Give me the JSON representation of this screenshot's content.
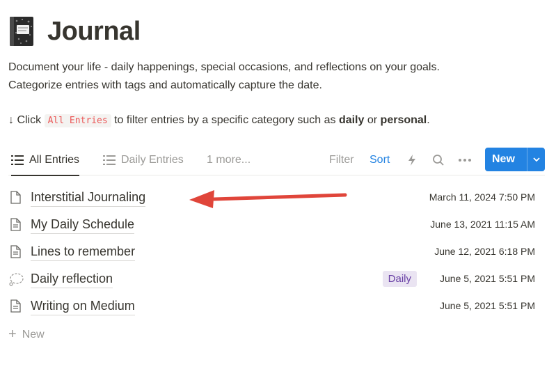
{
  "page": {
    "title": "Journal",
    "icon": "composition-notebook-icon",
    "description_line1": "Document your life - daily happenings, special occasions, and reflections on your goals.",
    "description_line2": "Categorize entries with tags and automatically capture the date.",
    "hint_prefix": "↓ Click",
    "hint_code": "All Entries",
    "hint_middle": "to filter entries by a specific category such as",
    "hint_bold1": "daily",
    "hint_or": "or",
    "hint_bold2": "personal",
    "hint_end": "."
  },
  "views": {
    "tabs": [
      {
        "label": "All Entries",
        "active": true
      },
      {
        "label": "Daily Entries",
        "active": false
      }
    ],
    "more_label": "1 more...",
    "filter_label": "Filter",
    "sort_label": "Sort",
    "new_label": "New"
  },
  "entries": [
    {
      "title": "Interstitial Journaling",
      "date": "March 11, 2024 7:50 PM",
      "tag": "",
      "icon": "page-icon"
    },
    {
      "title": "My Daily Schedule",
      "date": "June 13, 2021 11:15 AM",
      "tag": "",
      "icon": "doc-icon"
    },
    {
      "title": "Lines to remember",
      "date": "June 12, 2021 6:18 PM",
      "tag": "",
      "icon": "doc-icon"
    },
    {
      "title": "Daily reflection",
      "date": "June 5, 2021 5:51 PM",
      "tag": "Daily",
      "icon": "thought-bubble-icon"
    },
    {
      "title": "Writing on Medium",
      "date": "June 5, 2021 5:51 PM",
      "tag": "",
      "icon": "doc-icon"
    }
  ],
  "add_new_label": "New",
  "colors": {
    "accent": "#2383e2",
    "text": "#37352f",
    "muted": "#9b9a97",
    "code": "#eb5757",
    "tag_bg": "#eae4f2",
    "tag_text": "#6940a5",
    "arrow": "#e0453a"
  }
}
